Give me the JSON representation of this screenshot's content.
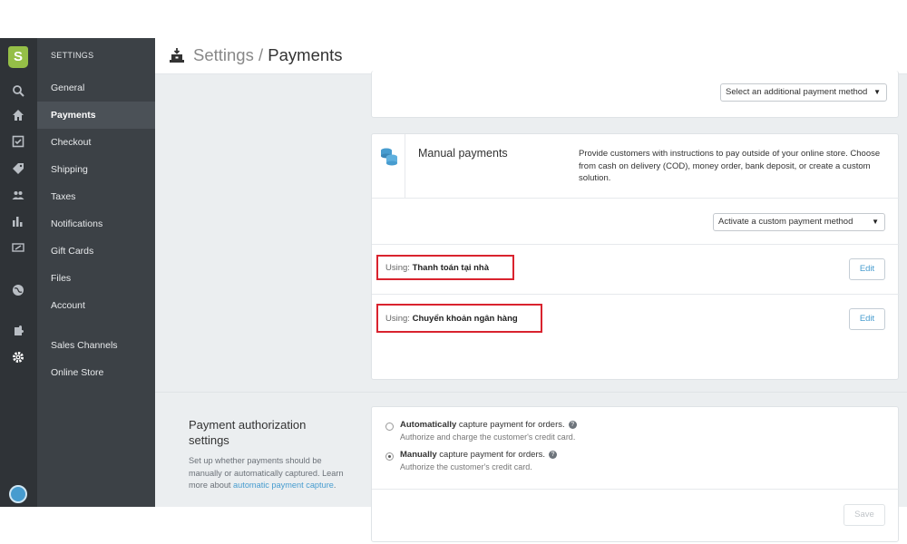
{
  "rail": {
    "logo_letter": "S",
    "icons": [
      "search-icon",
      "home-icon",
      "orders-icon",
      "products-icon",
      "customers-icon",
      "reports-icon",
      "discounts-icon",
      "online-store-icon",
      "apps-icon",
      "settings-icon"
    ]
  },
  "sidebar": {
    "heading": "SETTINGS",
    "items": [
      {
        "label": "General",
        "active": false
      },
      {
        "label": "Payments",
        "active": true
      },
      {
        "label": "Checkout",
        "active": false
      },
      {
        "label": "Shipping",
        "active": false
      },
      {
        "label": "Taxes",
        "active": false
      },
      {
        "label": "Notifications",
        "active": false
      },
      {
        "label": "Gift Cards",
        "active": false
      },
      {
        "label": "Files",
        "active": false
      },
      {
        "label": "Account",
        "active": false
      },
      {
        "label": "Sales Channels",
        "active": false
      },
      {
        "label": "Online Store",
        "active": false
      }
    ]
  },
  "header": {
    "crumb_parent": "Settings",
    "crumb_sep": " / ",
    "crumb_current": "Payments"
  },
  "additional": {
    "select_value": "Select an additional payment method"
  },
  "manual": {
    "title": "Manual payments",
    "description": "Provide customers with instructions to pay outside of your online store. Choose from cash on delivery (COD), money order, bank deposit, or create a custom solution.",
    "select_value": "Activate a custom payment method",
    "methods": [
      {
        "using_label": "Using:",
        "name": "Thanh toán tại nhà",
        "edit_label": "Edit"
      },
      {
        "using_label": "Using:",
        "name": "Chuyển khoản ngân hàng",
        "edit_label": "Edit"
      }
    ]
  },
  "authorization": {
    "title": "Payment authorization settings",
    "description": "Set up whether payments should be manually or automatically captured. Learn more about",
    "link": "automatic payment capture",
    "link_suffix": ".",
    "options": [
      {
        "bold": "Automatically",
        "rest": " capture payment for orders.",
        "sub": "Authorize and charge the customer's credit card.",
        "checked": false
      },
      {
        "bold": "Manually",
        "rest": " capture payment for orders.",
        "sub": "Authorize the customer's credit card.",
        "checked": true
      }
    ],
    "save_label": "Save",
    "help_glyph": "?"
  },
  "colors": {
    "accent": "#479ccf",
    "highlight": "#d9232e",
    "rail_bg": "#2f3337",
    "sidebar_bg": "#3c4146",
    "brand": "#95bf47"
  }
}
